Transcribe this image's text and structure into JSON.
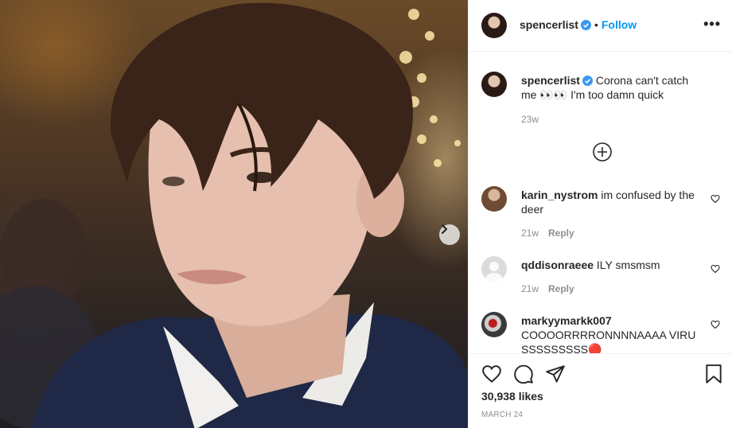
{
  "post": {
    "author": "spencerlist",
    "follow_label": "Follow",
    "separator": "•",
    "more_label": "•••",
    "caption": {
      "username": "spencerlist",
      "text": "Corona can't catch me 👀👀 I'm too damn quick",
      "time": "23w"
    },
    "likes": "30,938 likes",
    "date": "MARCH 24"
  },
  "comments": [
    {
      "username": "karin_nystrom",
      "text": "im confused by the deer",
      "time": "21w",
      "reply_label": "Reply"
    },
    {
      "username": "qddisonraeee",
      "text": "ILY smsmsm",
      "time": "21w",
      "reply_label": "Reply"
    },
    {
      "username": "markyymarkk007",
      "text": "COOOORRRRONNNNAAAA VIRUSSSSSSSSS🔴",
      "time": "",
      "reply_label": ""
    }
  ],
  "colors": {
    "accent": "#0095f6",
    "verified": "#3897f0",
    "muted": "#8e8e8e",
    "text": "#262626"
  },
  "icons": {
    "verified": "verified-badge-icon",
    "load_more": "plus-circle-icon",
    "like": "heart-icon",
    "comment": "comment-bubble-icon",
    "share": "paper-plane-icon",
    "save": "bookmark-icon",
    "next": "chevron-right-icon"
  }
}
